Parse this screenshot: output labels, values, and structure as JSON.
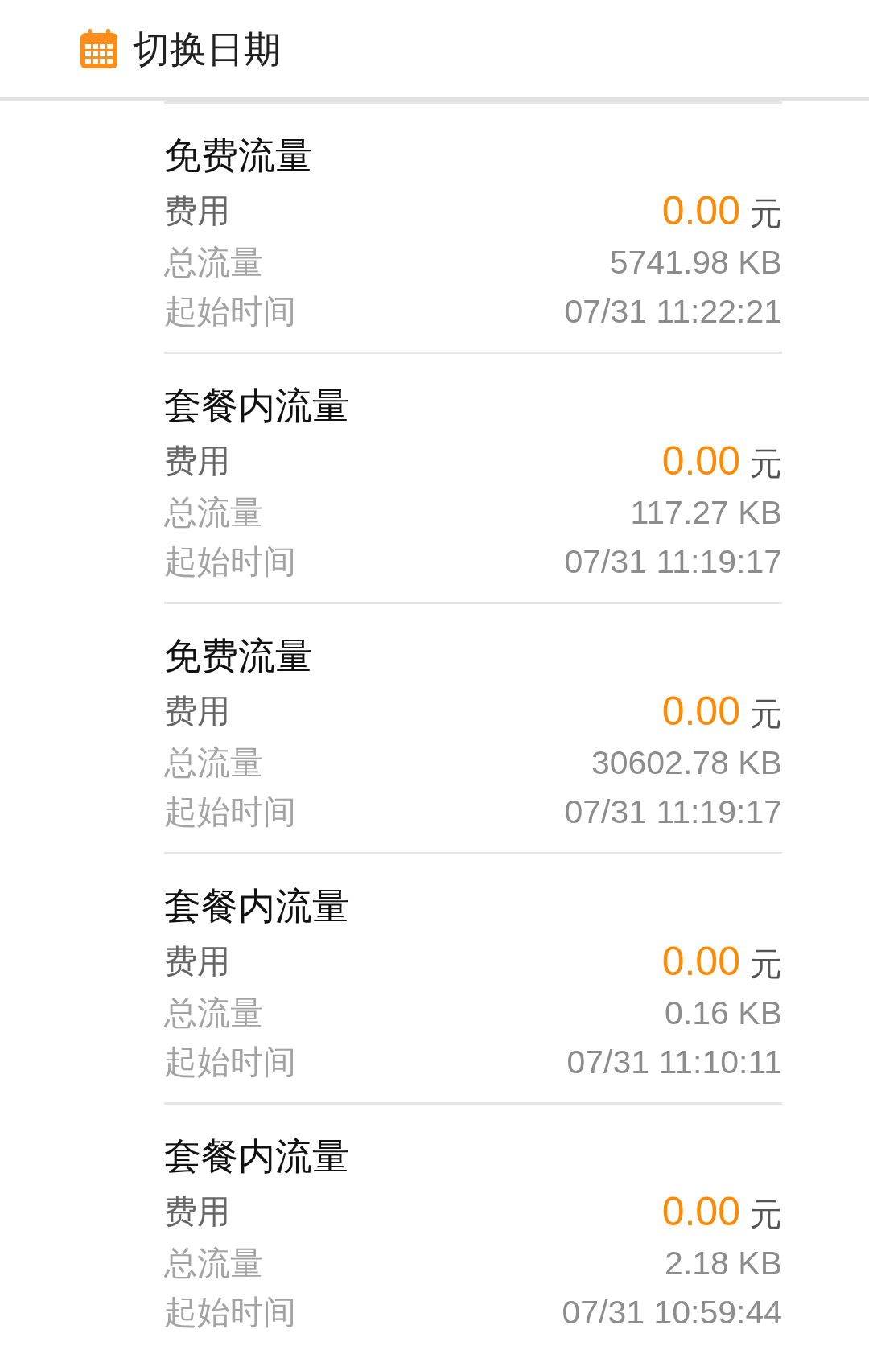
{
  "header": {
    "title": "切换日期"
  },
  "records": [
    {
      "title": "免费流量",
      "fee_label": "费用",
      "fee_value": "0.00",
      "fee_unit": "元",
      "total_label": "总流量",
      "total_value": "5741.98 KB",
      "start_label": "起始时间",
      "start_value": "07/31 11:22:21"
    },
    {
      "title": "套餐内流量",
      "fee_label": "费用",
      "fee_value": "0.00",
      "fee_unit": "元",
      "total_label": "总流量",
      "total_value": "117.27 KB",
      "start_label": "起始时间",
      "start_value": "07/31 11:19:17"
    },
    {
      "title": "免费流量",
      "fee_label": "费用",
      "fee_value": "0.00",
      "fee_unit": "元",
      "total_label": "总流量",
      "total_value": "30602.78 KB",
      "start_label": "起始时间",
      "start_value": "07/31 11:19:17"
    },
    {
      "title": "套餐内流量",
      "fee_label": "费用",
      "fee_value": "0.00",
      "fee_unit": "元",
      "total_label": "总流量",
      "total_value": "0.16 KB",
      "start_label": "起始时间",
      "start_value": "07/31 11:10:11"
    },
    {
      "title": "套餐内流量",
      "fee_label": "费用",
      "fee_value": "0.00",
      "fee_unit": "元",
      "total_label": "总流量",
      "total_value": "2.18 KB",
      "start_label": "起始时间",
      "start_value": "07/31 10:59:44"
    }
  ]
}
